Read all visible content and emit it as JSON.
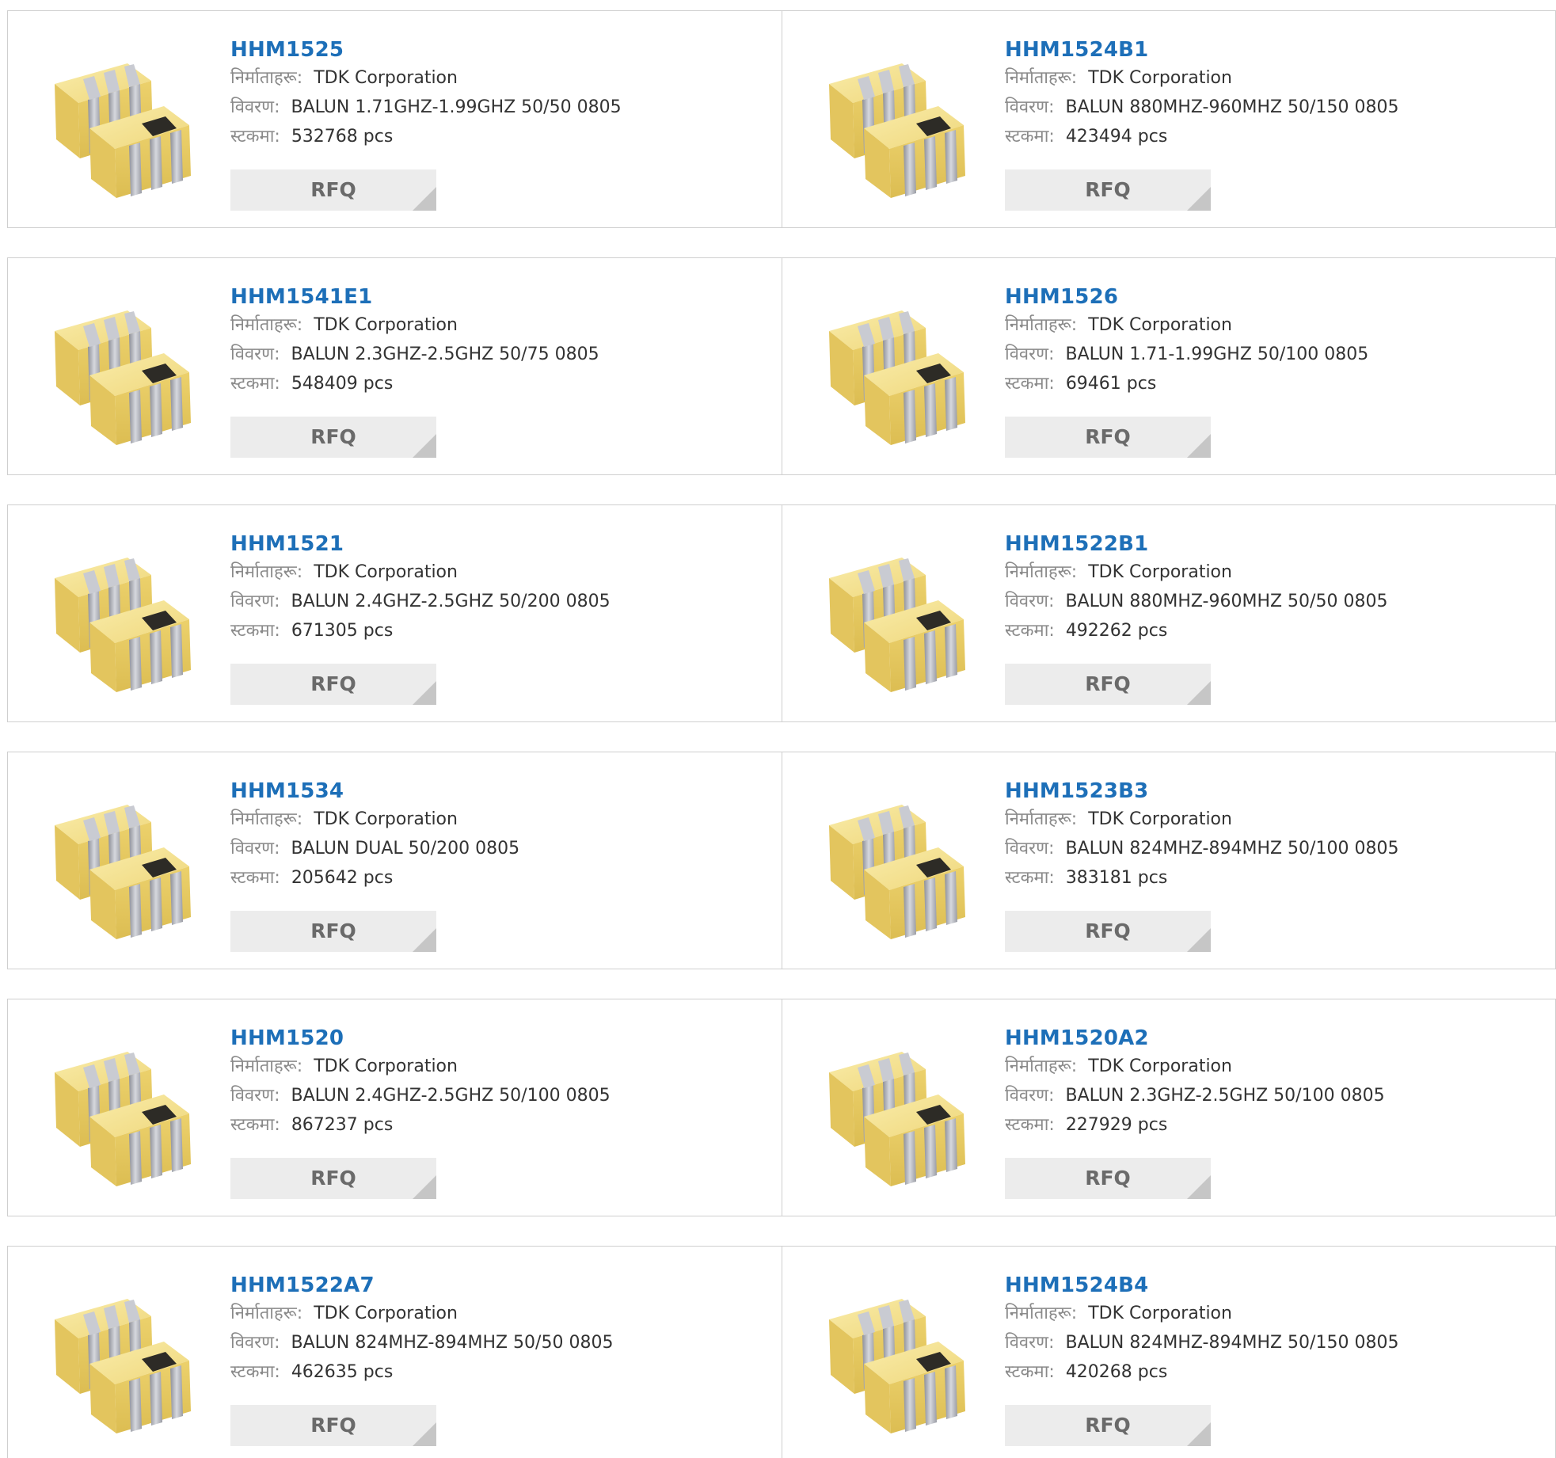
{
  "labels": {
    "manufacturer": "निर्माताहरू:",
    "description": "विवरण:",
    "stock": "स्टकमा:",
    "rfq": "RFQ"
  },
  "products": [
    {
      "part": "HHM1525",
      "manufacturer": "TDK Corporation",
      "description": "BALUN 1.71GHZ-1.99GHZ 50/50 0805",
      "stock": "532768 pcs"
    },
    {
      "part": "HHM1524B1",
      "manufacturer": "TDK Corporation",
      "description": "BALUN 880MHZ-960MHZ 50/150 0805",
      "stock": "423494 pcs"
    },
    {
      "part": "HHM1541E1",
      "manufacturer": "TDK Corporation",
      "description": "BALUN 2.3GHZ-2.5GHZ 50/75 0805",
      "stock": "548409 pcs"
    },
    {
      "part": "HHM1526",
      "manufacturer": "TDK Corporation",
      "description": "BALUN 1.71-1.99GHZ 50/100 0805",
      "stock": "69461 pcs"
    },
    {
      "part": "HHM1521",
      "manufacturer": "TDK Corporation",
      "description": "BALUN 2.4GHZ-2.5GHZ 50/200 0805",
      "stock": "671305 pcs"
    },
    {
      "part": "HHM1522B1",
      "manufacturer": "TDK Corporation",
      "description": "BALUN 880MHZ-960MHZ 50/50 0805",
      "stock": "492262 pcs"
    },
    {
      "part": "HHM1534",
      "manufacturer": "TDK Corporation",
      "description": "BALUN DUAL 50/200 0805",
      "stock": "205642 pcs"
    },
    {
      "part": "HHM1523B3",
      "manufacturer": "TDK Corporation",
      "description": "BALUN 824MHZ-894MHZ 50/100 0805",
      "stock": "383181 pcs"
    },
    {
      "part": "HHM1520",
      "manufacturer": "TDK Corporation",
      "description": "BALUN 2.4GHZ-2.5GHZ 50/100 0805",
      "stock": "867237 pcs"
    },
    {
      "part": "HHM1520A2",
      "manufacturer": "TDK Corporation",
      "description": "BALUN 2.3GHZ-2.5GHZ 50/100 0805",
      "stock": "227929 pcs"
    },
    {
      "part": "HHM1522A7",
      "manufacturer": "TDK Corporation",
      "description": "BALUN 824MHZ-894MHZ 50/50 0805",
      "stock": "462635 pcs"
    },
    {
      "part": "HHM1524B4",
      "manufacturer": "TDK Corporation",
      "description": "BALUN 824MHZ-894MHZ 50/150 0805",
      "stock": "420268 pcs"
    }
  ]
}
